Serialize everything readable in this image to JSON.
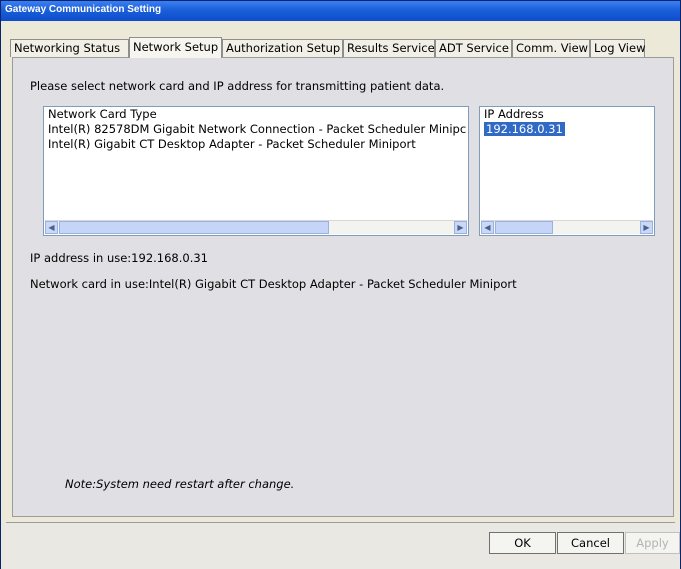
{
  "window": {
    "title": "Gateway Communication Setting"
  },
  "tabs": [
    {
      "label": "Networking Status",
      "active": false
    },
    {
      "label": "Network Setup",
      "active": true
    },
    {
      "label": "Authorization Setup",
      "active": false
    },
    {
      "label": "Results Service",
      "active": false
    },
    {
      "label": "ADT Service",
      "active": false
    },
    {
      "label": "Comm. View",
      "active": false
    },
    {
      "label": "Log View",
      "active": false
    }
  ],
  "panel": {
    "prompt": "Please select network card and IP address for transmitting patient data.",
    "network_list": {
      "header": "Network Card Type",
      "rows": [
        "Intel(R) 82578DM Gigabit Network Connection - Packet Scheduler Minipc",
        "Intel(R) Gigabit CT Desktop Adapter - Packet Scheduler Miniport"
      ]
    },
    "ip_list": {
      "header": "IP Address",
      "rows": [
        "192.168.0.31"
      ],
      "selected": "192.168.0.31"
    },
    "ip_in_use": "IP address in use:192.168.0.31",
    "card_in_use": "Network card in use:Intel(R) Gigabit CT Desktop Adapter - Packet Scheduler Miniport",
    "note": "Note:System need restart after change."
  },
  "buttons": {
    "ok": "OK",
    "cancel": "Cancel",
    "apply": "Apply"
  },
  "icons": {
    "scroll_left": "scroll-left-arrow-icon",
    "scroll_right": "scroll-right-arrow-icon"
  },
  "colors": {
    "titlebar": "#1b5fd9",
    "selection": "#316ac5"
  }
}
